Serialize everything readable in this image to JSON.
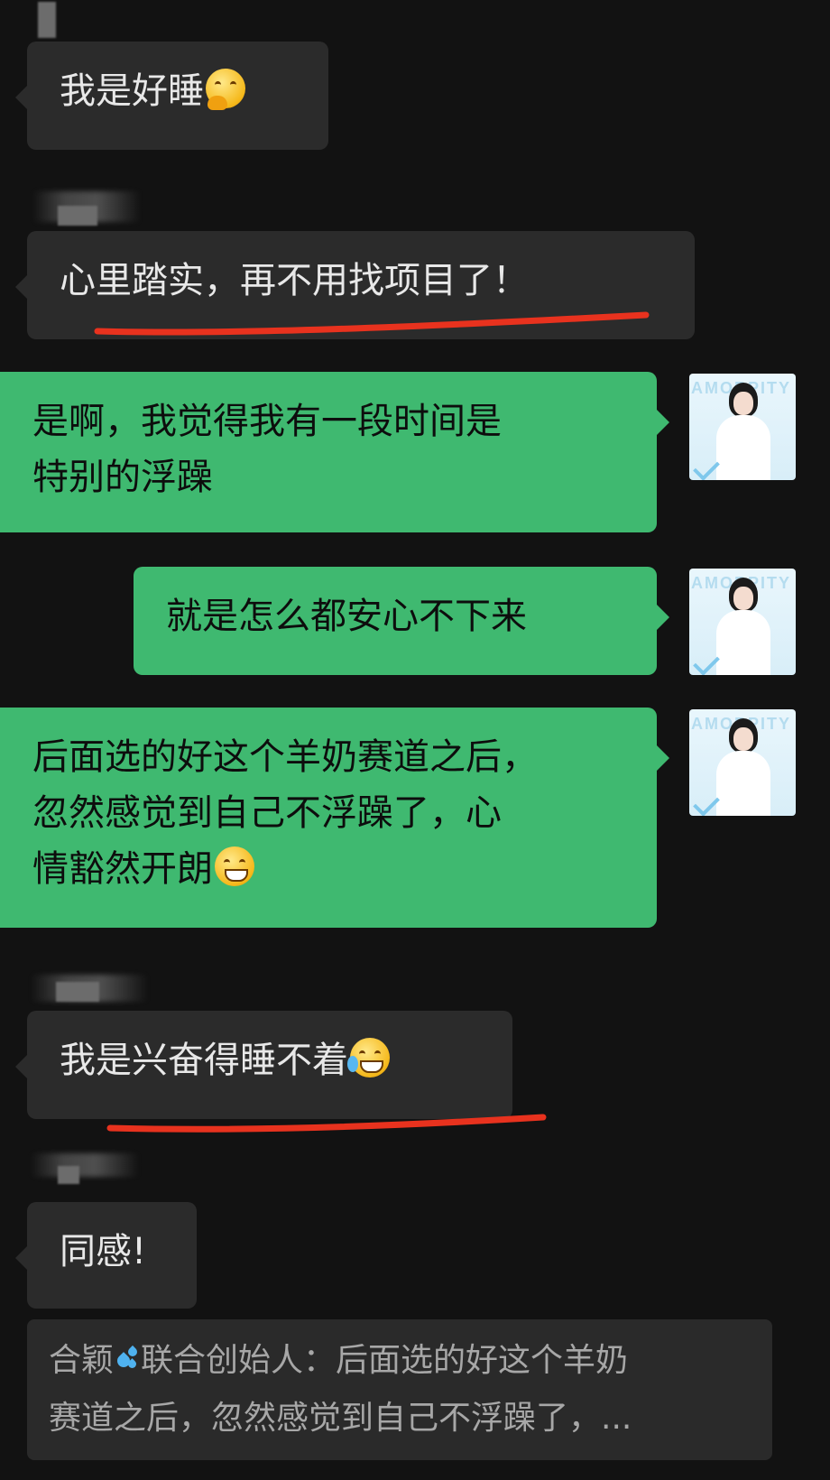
{
  "messages": {
    "m1": {
      "text": "我是好睡",
      "emoji": "hand-over-mouth-emoji"
    },
    "m2": {
      "text": "心里踏实，再不用找项目了！"
    },
    "m3": {
      "line1": "是啊，我觉得我有一段时间是",
      "line2": "特别的浮躁"
    },
    "m4": {
      "text": "就是怎么都安心不下来"
    },
    "m5": {
      "line1": "后面选的好这个羊奶赛道之后，",
      "line2": "忽然感觉到自己不浮躁了，心",
      "line3": "情豁然开朗",
      "emoji": "grinning-emoji"
    },
    "m6": {
      "text": "我是兴奋得睡不着",
      "emoji": "crying-laughing-emoji"
    },
    "m7": {
      "text": "同感!"
    }
  },
  "quote": {
    "prefix": "合颖",
    "rest_line1": "联合创始人：后面选的好这个羊奶",
    "line2": "赛道之后，忽然感觉到自己不浮躁了，..."
  },
  "avatar": {
    "brand": "AMORPITY"
  },
  "colors": {
    "background": "#121212",
    "incoming_bubble": "#2b2b2b",
    "outgoing_bubble": "#3fb970",
    "highlight_underline": "#e8321e"
  }
}
